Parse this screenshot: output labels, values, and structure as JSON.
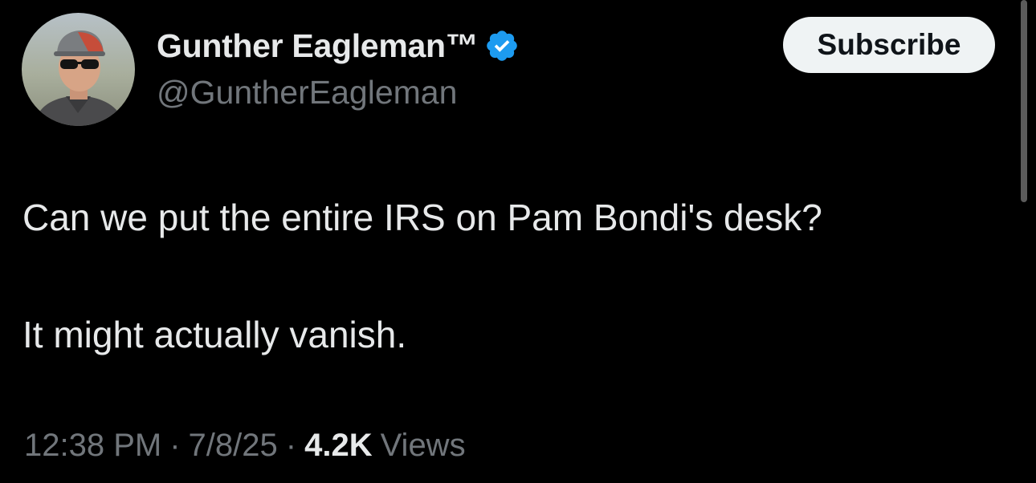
{
  "author": {
    "display_name": "Gunther Eagleman™",
    "handle": "@GuntherEagleman",
    "verified_icon": "verified-badge-icon",
    "verified_color": "#1d9bf0"
  },
  "subscribe_label": "Subscribe",
  "tweet": {
    "line1": "Can we put the entire IRS on Pam Bondi's desk?",
    "line2": "It might actually vanish."
  },
  "meta": {
    "time": "12:38 PM",
    "separator": "·",
    "date": "7/8/25",
    "views_count": "4.2K",
    "views_label": "Views"
  }
}
